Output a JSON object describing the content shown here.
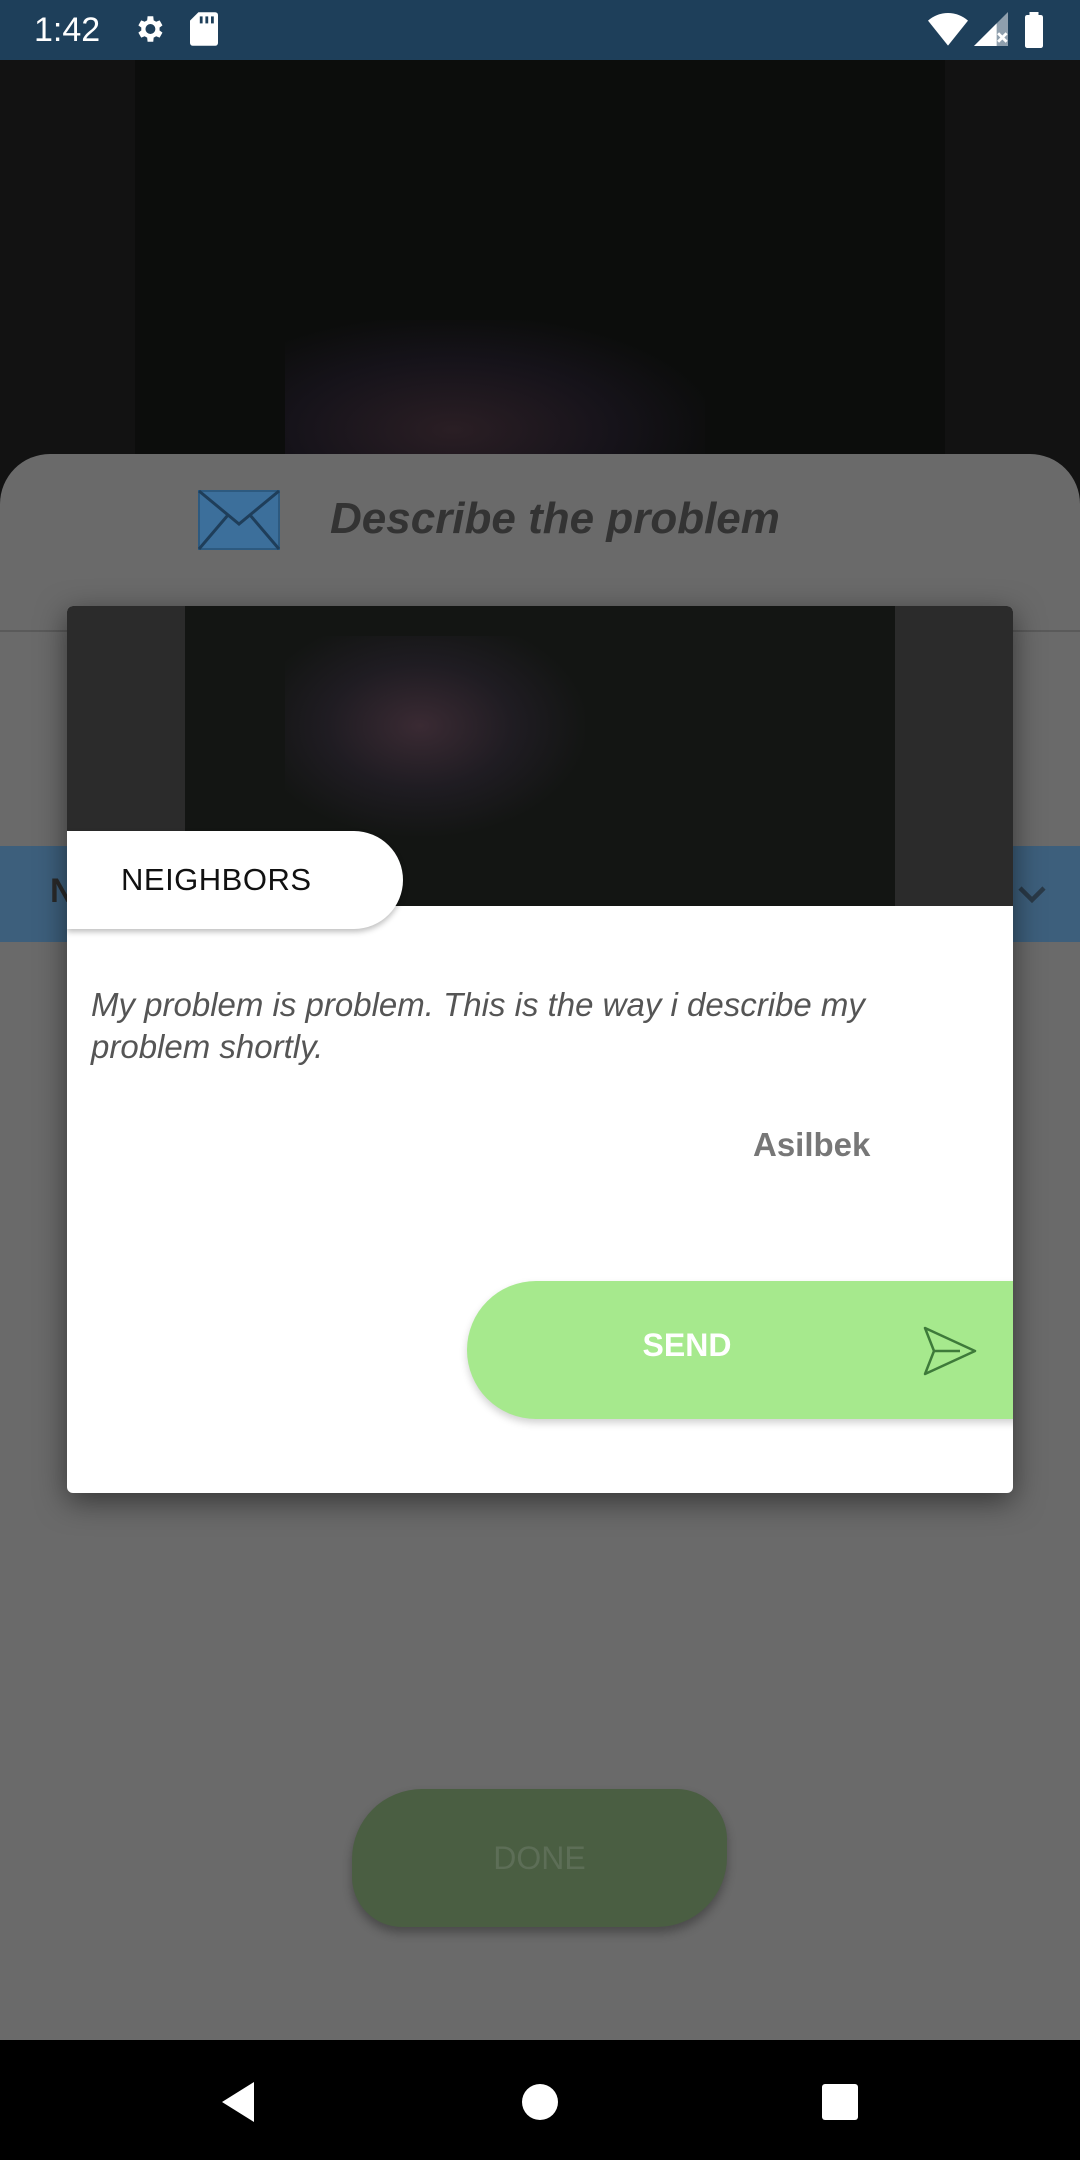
{
  "status_bar": {
    "time": "1:42",
    "icons": [
      "settings-icon",
      "sd-card-icon",
      "wifi-icon",
      "signal-icon",
      "battery-icon"
    ]
  },
  "sheet": {
    "header_icon": "mail-icon",
    "title": "Describe the problem",
    "band_letter": "N",
    "done_label": "DONE"
  },
  "dialog": {
    "category": "NEIGHBORS",
    "description": "My problem is problem. This is the way i describe my problem shortly.",
    "author": "Asilbek",
    "send_label": "SEND"
  },
  "colors": {
    "status_bar": "#1e3f5a",
    "send_green": "#a6e98d",
    "mail_blue": "#3c6f9b"
  }
}
